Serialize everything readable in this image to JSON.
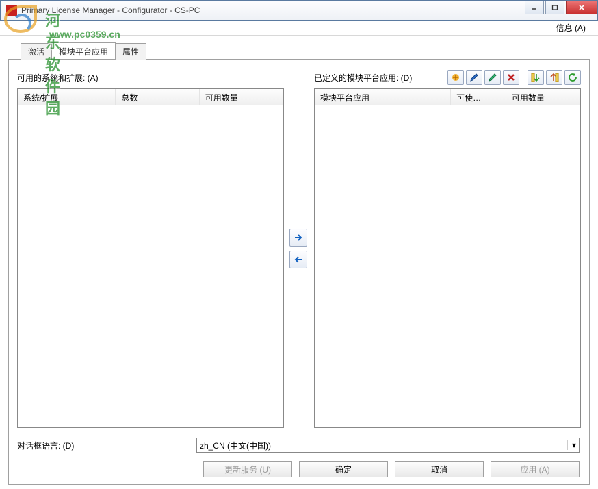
{
  "window": {
    "title": "Primary License Manager - Configurator - CS-PC"
  },
  "watermark": {
    "text": "河东软件园",
    "url": "www.pc0359.cn"
  },
  "menu": {
    "info": "信息 (A)"
  },
  "tabs": {
    "activate": "激活",
    "modules": "模块平台应用",
    "attributes": "属性"
  },
  "left": {
    "label": "可用的系统和扩展: (A)",
    "cols": {
      "c1": "系统/扩展",
      "c2": "总数",
      "c3": "可用数量"
    }
  },
  "right": {
    "label": "已定义的模块平台应用: (D)",
    "cols": {
      "c1": "模块平台应用",
      "c2": "可使…",
      "c3": "可用数量"
    }
  },
  "lang": {
    "label": "对话框语言: (D)",
    "value": "zh_CN (中文(中国))"
  },
  "buttons": {
    "update": "更新服务 (U)",
    "ok": "确定",
    "cancel": "取消",
    "apply": "应用 (A)"
  }
}
